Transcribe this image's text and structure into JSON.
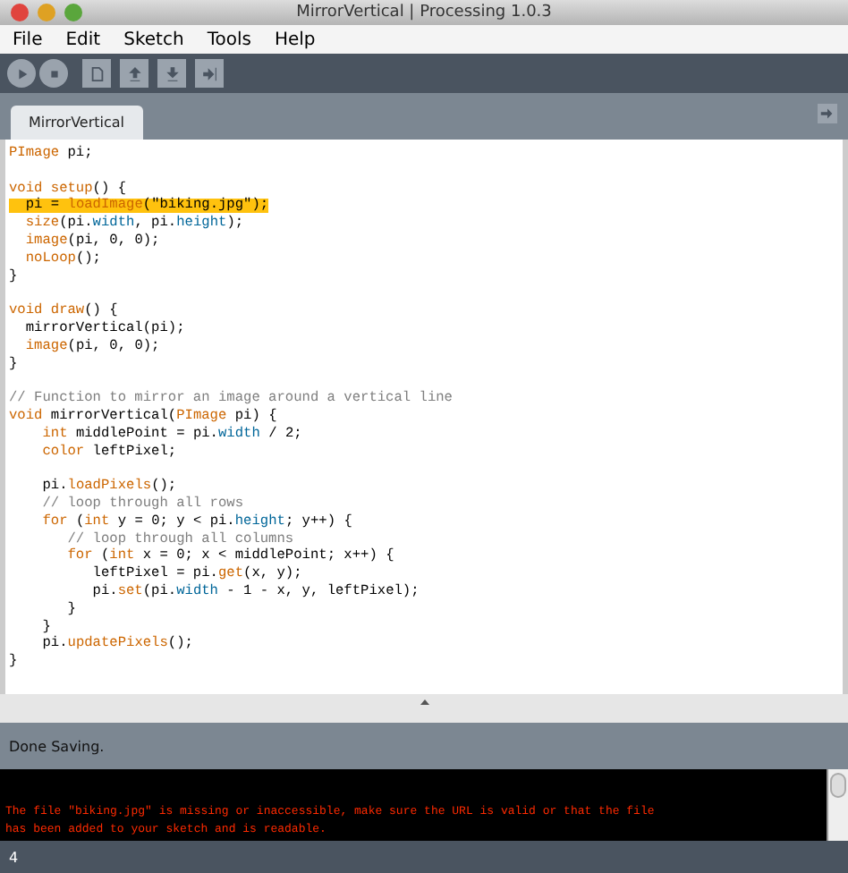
{
  "window": {
    "title": "MirrorVertical | Processing 1.0.3"
  },
  "menu": [
    "File",
    "Edit",
    "Sketch",
    "Tools",
    "Help"
  ],
  "tabs": [
    {
      "label": "MirrorVertical",
      "selected": true
    }
  ],
  "editor": {
    "lines": [
      {
        "kind": "code",
        "highlighted": false,
        "tokens": [
          {
            "text": "PImage",
            "kind": "keyword"
          },
          {
            "text": " pi;",
            "kind": "plain"
          }
        ]
      },
      {
        "kind": "blank"
      },
      {
        "kind": "code",
        "highlighted": false,
        "tokens": [
          {
            "text": "void setup",
            "kind": "keyword"
          },
          {
            "text": "() {",
            "kind": "plain"
          }
        ]
      },
      {
        "kind": "code",
        "highlighted": true,
        "tokens": [
          {
            "text": "  pi = ",
            "kind": "plain"
          },
          {
            "text": "loadImage",
            "kind": "keyword"
          },
          {
            "text": "(\"biking.jpg\");",
            "kind": "plain"
          }
        ]
      },
      {
        "kind": "code",
        "highlighted": false,
        "tokens": [
          {
            "text": "  size",
            "kind": "keyword"
          },
          {
            "text": "(pi.",
            "kind": "plain"
          },
          {
            "text": "width",
            "kind": "field"
          },
          {
            "text": ", pi.",
            "kind": "plain"
          },
          {
            "text": "height",
            "kind": "field"
          },
          {
            "text": ");",
            "kind": "plain"
          }
        ]
      },
      {
        "kind": "code",
        "highlighted": false,
        "tokens": [
          {
            "text": "  image",
            "kind": "keyword"
          },
          {
            "text": "(pi, 0, 0);",
            "kind": "plain"
          }
        ]
      },
      {
        "kind": "code",
        "highlighted": false,
        "tokens": [
          {
            "text": "  noLoop",
            "kind": "keyword"
          },
          {
            "text": "();",
            "kind": "plain"
          }
        ]
      },
      {
        "kind": "code",
        "highlighted": false,
        "tokens": [
          {
            "text": "}",
            "kind": "plain"
          }
        ]
      },
      {
        "kind": "blank"
      },
      {
        "kind": "code",
        "highlighted": false,
        "tokens": [
          {
            "text": "void draw",
            "kind": "keyword"
          },
          {
            "text": "() {",
            "kind": "plain"
          }
        ]
      },
      {
        "kind": "code",
        "highlighted": false,
        "tokens": [
          {
            "text": "  mirrorVertical(pi);",
            "kind": "plain"
          }
        ]
      },
      {
        "kind": "code",
        "highlighted": false,
        "tokens": [
          {
            "text": "  image",
            "kind": "keyword"
          },
          {
            "text": "(pi, 0, 0);",
            "kind": "plain"
          }
        ]
      },
      {
        "kind": "code",
        "highlighted": false,
        "tokens": [
          {
            "text": "}",
            "kind": "plain"
          }
        ]
      },
      {
        "kind": "blank"
      },
      {
        "kind": "code",
        "highlighted": false,
        "tokens": [
          {
            "text": "// Function to mirror an image around a vertical line",
            "kind": "comment"
          }
        ]
      },
      {
        "kind": "code",
        "highlighted": false,
        "tokens": [
          {
            "text": "void",
            "kind": "keyword"
          },
          {
            "text": " mirrorVertical(",
            "kind": "plain"
          },
          {
            "text": "PImage",
            "kind": "keyword"
          },
          {
            "text": " pi) {",
            "kind": "plain"
          }
        ]
      },
      {
        "kind": "code",
        "highlighted": false,
        "tokens": [
          {
            "text": "    int",
            "kind": "keyword"
          },
          {
            "text": " middlePoint = pi.",
            "kind": "plain"
          },
          {
            "text": "width",
            "kind": "field"
          },
          {
            "text": " / 2;",
            "kind": "plain"
          }
        ]
      },
      {
        "kind": "code",
        "highlighted": false,
        "tokens": [
          {
            "text": "    color",
            "kind": "keyword"
          },
          {
            "text": " leftPixel;",
            "kind": "plain"
          }
        ]
      },
      {
        "kind": "blank"
      },
      {
        "kind": "code",
        "highlighted": false,
        "tokens": [
          {
            "text": "    pi.",
            "kind": "plain"
          },
          {
            "text": "loadPixels",
            "kind": "keyword"
          },
          {
            "text": "();",
            "kind": "plain"
          }
        ]
      },
      {
        "kind": "code",
        "highlighted": false,
        "tokens": [
          {
            "text": "    // loop through all rows",
            "kind": "comment"
          }
        ]
      },
      {
        "kind": "code",
        "highlighted": false,
        "tokens": [
          {
            "text": "    for",
            "kind": "keyword"
          },
          {
            "text": " (",
            "kind": "plain"
          },
          {
            "text": "int",
            "kind": "keyword"
          },
          {
            "text": " y = 0; y < pi.",
            "kind": "plain"
          },
          {
            "text": "height",
            "kind": "field"
          },
          {
            "text": "; y++) {",
            "kind": "plain"
          }
        ]
      },
      {
        "kind": "code",
        "highlighted": false,
        "tokens": [
          {
            "text": "       // loop through all columns",
            "kind": "comment"
          }
        ]
      },
      {
        "kind": "code",
        "highlighted": false,
        "tokens": [
          {
            "text": "       for",
            "kind": "keyword"
          },
          {
            "text": " (",
            "kind": "plain"
          },
          {
            "text": "int",
            "kind": "keyword"
          },
          {
            "text": " x = 0; x < middlePoint; x++) {",
            "kind": "plain"
          }
        ]
      },
      {
        "kind": "code",
        "highlighted": false,
        "tokens": [
          {
            "text": "          leftPixel = pi.",
            "kind": "plain"
          },
          {
            "text": "get",
            "kind": "keyword"
          },
          {
            "text": "(x, y);",
            "kind": "plain"
          }
        ]
      },
      {
        "kind": "code",
        "highlighted": false,
        "tokens": [
          {
            "text": "          pi.",
            "kind": "plain"
          },
          {
            "text": "set",
            "kind": "keyword"
          },
          {
            "text": "(pi.",
            "kind": "plain"
          },
          {
            "text": "width",
            "kind": "field"
          },
          {
            "text": " - 1 - x, y, leftPixel);",
            "kind": "plain"
          }
        ]
      },
      {
        "kind": "code",
        "highlighted": false,
        "tokens": [
          {
            "text": "       }",
            "kind": "plain"
          }
        ]
      },
      {
        "kind": "code",
        "highlighted": false,
        "tokens": [
          {
            "text": "    }",
            "kind": "plain"
          }
        ]
      },
      {
        "kind": "code",
        "highlighted": false,
        "tokens": [
          {
            "text": "    pi.",
            "kind": "plain"
          },
          {
            "text": "updatePixels",
            "kind": "keyword"
          },
          {
            "text": "();",
            "kind": "plain"
          }
        ]
      },
      {
        "kind": "code",
        "highlighted": false,
        "tokens": [
          {
            "text": "}",
            "kind": "plain"
          }
        ]
      }
    ]
  },
  "status": "Done Saving.",
  "console": [
    "The file \"biking.jpg\" is missing or inaccessible, make sure the URL is valid or that the file",
    "has been added to your sketch and is readable."
  ],
  "line_number": "4"
}
